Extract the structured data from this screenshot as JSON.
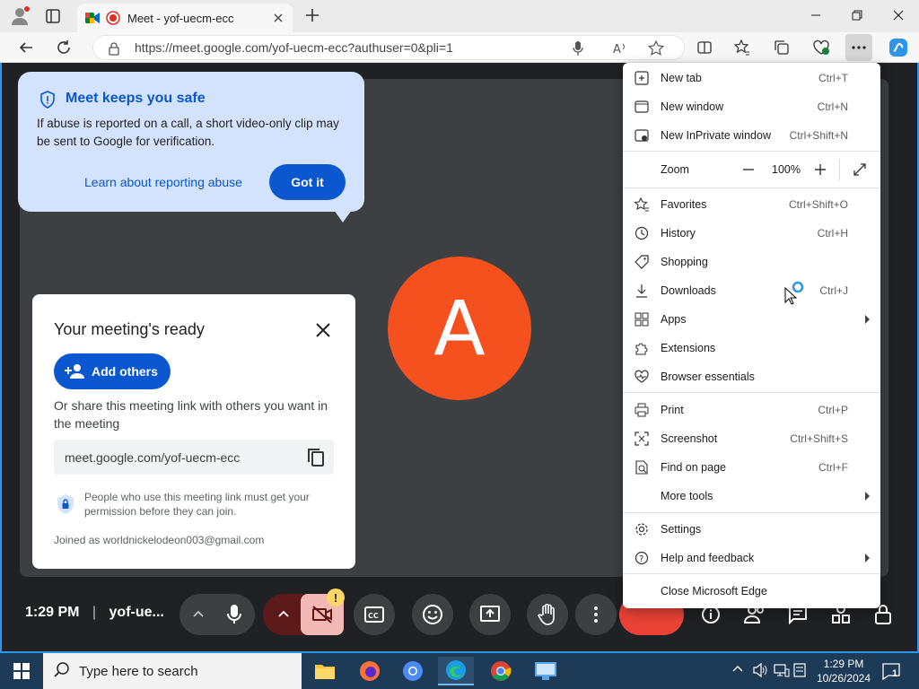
{
  "browser": {
    "tab_title": "Meet - yof-uecm-ecc",
    "url": "https://meet.google.com/yof-uecm-ecc?authuser=0&pli=1"
  },
  "safety": {
    "title": "Meet keeps you safe",
    "text": "If abuse is reported on a call, a short video-only clip may be sent to Google for verification.",
    "link": "Learn about reporting abuse",
    "button": "Got it"
  },
  "avatar": {
    "letter": "A",
    "color": "#f4511e"
  },
  "ready": {
    "title": "Your meeting's ready",
    "add_button": "Add others",
    "share_text": "Or share this meeting link with others you want in the meeting",
    "link": "meet.google.com/yof-uecm-ecc",
    "permission_text": "People who use this meeting link must get your permission before they can join.",
    "joined_as": "Joined as worldnickelodeon003@gmail.com"
  },
  "meeting_bar": {
    "time": "1:29 PM",
    "code": "yof-ue..."
  },
  "menu": {
    "items": [
      {
        "label": "New tab",
        "shortcut": "Ctrl+T"
      },
      {
        "label": "New window",
        "shortcut": "Ctrl+N"
      },
      {
        "label": "New InPrivate window",
        "shortcut": "Ctrl+Shift+N"
      },
      {
        "label": "Zoom",
        "zoom": "100%"
      },
      {
        "label": "Favorites",
        "shortcut": "Ctrl+Shift+O"
      },
      {
        "label": "History",
        "shortcut": "Ctrl+H"
      },
      {
        "label": "Shopping",
        "shortcut": ""
      },
      {
        "label": "Downloads",
        "shortcut": "Ctrl+J"
      },
      {
        "label": "Apps",
        "shortcut": ""
      },
      {
        "label": "Extensions",
        "shortcut": ""
      },
      {
        "label": "Browser essentials",
        "shortcut": ""
      },
      {
        "label": "Print",
        "shortcut": "Ctrl+P"
      },
      {
        "label": "Screenshot",
        "shortcut": "Ctrl+Shift+S"
      },
      {
        "label": "Find on page",
        "shortcut": "Ctrl+F"
      },
      {
        "label": "More tools",
        "shortcut": ""
      },
      {
        "label": "Settings",
        "shortcut": ""
      },
      {
        "label": "Help and feedback",
        "shortcut": ""
      },
      {
        "label": "Close Microsoft Edge",
        "shortcut": ""
      }
    ]
  },
  "taskbar": {
    "search_placeholder": "Type here to search",
    "time": "1:29 PM",
    "date": "10/26/2024",
    "notification_count": "1"
  }
}
